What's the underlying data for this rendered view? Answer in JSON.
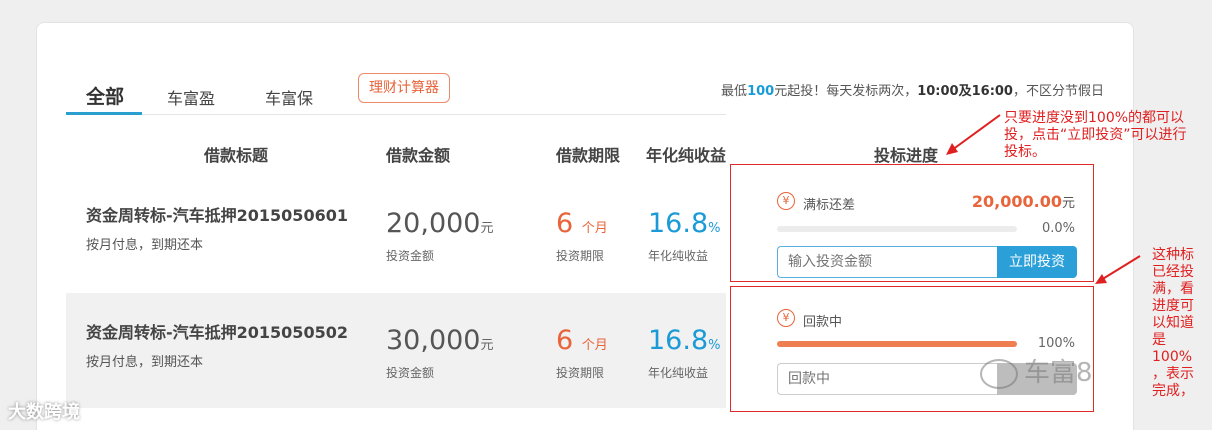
{
  "tabs": [
    {
      "label": "全部",
      "active": true
    },
    {
      "label": "车富盈",
      "active": false
    },
    {
      "label": "车富保",
      "active": false
    }
  ],
  "calculator_button": "理财计算器",
  "notice": {
    "prefix": "最低",
    "min_amount": "100",
    "middle": "元起投！每天发标两次，",
    "times": "10:00及16:00",
    "suffix": "，不区分节假日"
  },
  "headers": {
    "title": "借款标题",
    "amount": "借款金额",
    "term": "借款期限",
    "rate": "年化纯收益",
    "progress": "投标进度"
  },
  "loans": [
    {
      "title": "资金周转标-汽车抵押2015050601",
      "repayment": "按月付息，到期还本",
      "amount": "20,000",
      "amount_unit": "元",
      "amount_caption": "投资金额",
      "term": "6",
      "term_unit": "个月",
      "term_caption": "投资期限",
      "rate": "16.8",
      "rate_unit": "%",
      "rate_caption": "年化纯收益",
      "status": "满标还差",
      "remaining": "20,000.00",
      "remaining_unit": "元",
      "progress_text": "0.0%",
      "progress": 0,
      "input_placeholder": "输入投资金额",
      "button_label": "立即投资",
      "disabled": false
    },
    {
      "title": "资金周转标-汽车抵押2015050502",
      "repayment": "按月付息，到期还本",
      "amount": "30,000",
      "amount_unit": "元",
      "amount_caption": "投资金额",
      "term": "6",
      "term_unit": "个月",
      "term_caption": "投资期限",
      "rate": "16.8",
      "rate_unit": "%",
      "rate_caption": "年化纯收益",
      "status": "回款中",
      "progress_text": "100%",
      "progress": 1.0,
      "input_placeholder": "回款中",
      "button_label": "",
      "disabled": true
    }
  ],
  "annotations": {
    "top_lines": [
      "只要进度没到100%的都可以",
      "投，点击“立即投资”可以进行",
      "投标。"
    ],
    "side_lines": [
      "这种标",
      "已经投",
      "满，看",
      "进度可",
      "以知道",
      "是",
      "100%",
      "，表示",
      "完成，"
    ]
  },
  "watermarks": {
    "left": "大数跨境",
    "right": "车富8"
  },
  "colors": {
    "accent_blue": "#1a9ad6",
    "accent_orange": "#e8643a",
    "annotation_red": "#e02020"
  }
}
